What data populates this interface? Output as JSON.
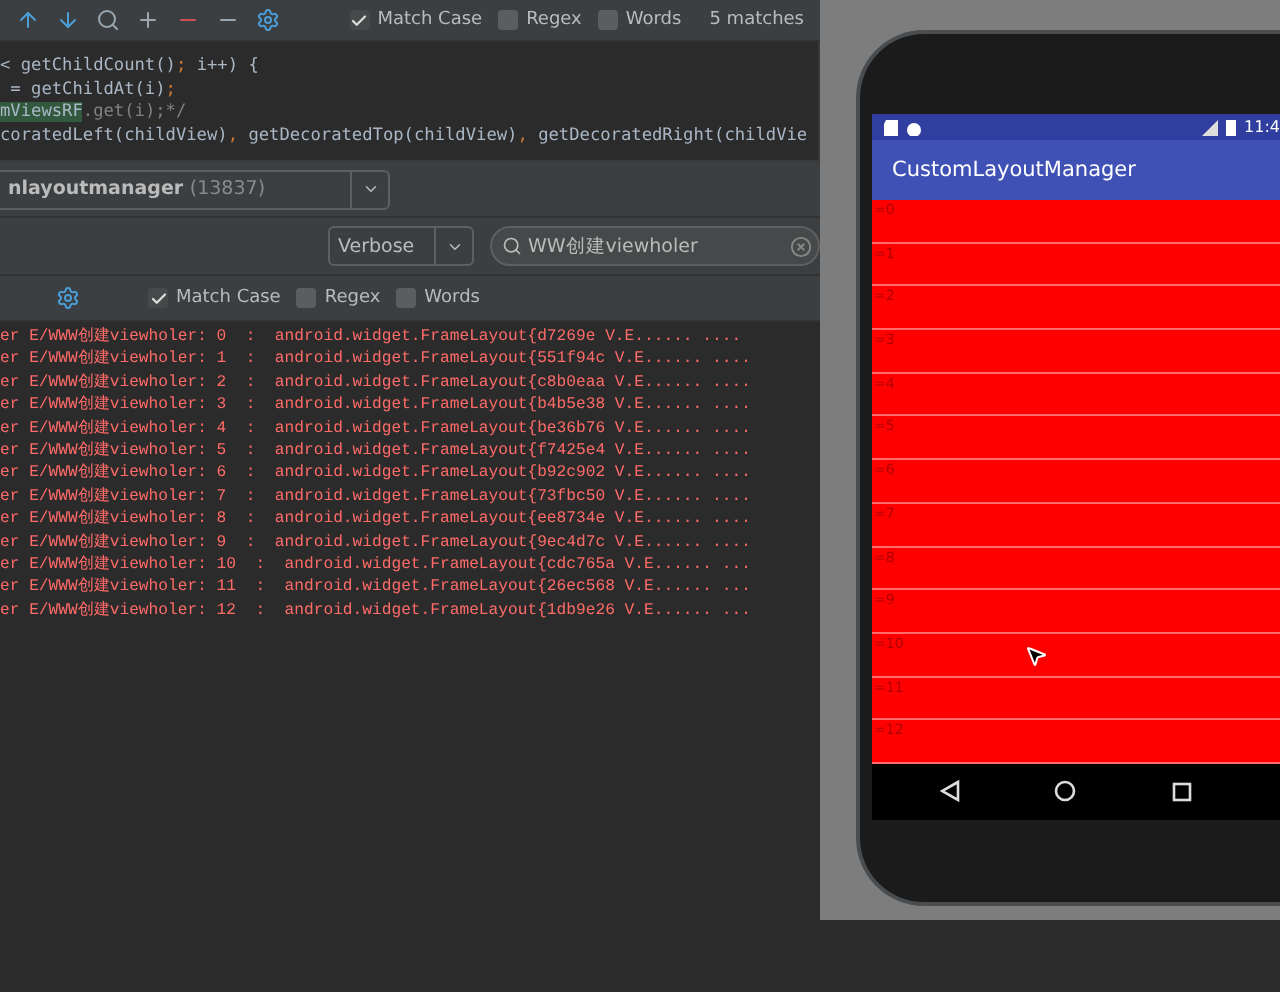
{
  "find_bar": {
    "options": [
      {
        "label": "Match Case",
        "checked": true
      },
      {
        "label": "Regex",
        "checked": false
      },
      {
        "label": "Words",
        "checked": false
      }
    ],
    "matches": "5 matches"
  },
  "code_lines": [
    [
      {
        "t": "< getChildCount()",
        "kind": "plain"
      },
      {
        "t": ";",
        "kind": "punct"
      },
      {
        "t": " i++) {",
        "kind": "plain"
      }
    ],
    [
      {
        "t": " = getChildAt(i)",
        "kind": "plain"
      },
      {
        "t": ";",
        "kind": "punct"
      }
    ],
    [
      {
        "t": "mViewsRF",
        "kind": "match"
      },
      {
        "t": ".get(i);*/",
        "kind": "comment"
      }
    ],
    [
      {
        "t": "coratedLeft(childView)",
        "kind": "plain"
      },
      {
        "t": ",",
        "kind": "punct"
      },
      {
        "t": " getDecoratedTop(childView)",
        "kind": "plain"
      },
      {
        "t": ",",
        "kind": "punct"
      },
      {
        "t": " getDecoratedRight(childVie",
        "kind": "plain"
      }
    ]
  ],
  "process": {
    "name": "nlayoutmanager",
    "pid": "(13837)"
  },
  "log_level": "Verbose",
  "log_search": {
    "value": "WW创建viewholer"
  },
  "log_find": {
    "options": [
      {
        "label": "Match Case",
        "checked": true
      },
      {
        "label": "Regex",
        "checked": false
      },
      {
        "label": "Words",
        "checked": false
      }
    ]
  },
  "log_lines": [
    "er E/WWW创建viewholer: 0  :  android.widget.FrameLayout{d7269e V.E...... ....",
    "er E/WWW创建viewholer: 1  :  android.widget.FrameLayout{551f94c V.E...... ....",
    "er E/WWW创建viewholer: 2  :  android.widget.FrameLayout{c8b0eaa V.E...... ....",
    "er E/WWW创建viewholer: 3  :  android.widget.FrameLayout{b4b5e38 V.E...... ....",
    "er E/WWW创建viewholer: 4  :  android.widget.FrameLayout{be36b76 V.E...... ....",
    "er E/WWW创建viewholer: 5  :  android.widget.FrameLayout{f7425e4 V.E...... ....",
    "er E/WWW创建viewholer: 6  :  android.widget.FrameLayout{b92c902 V.E...... ....",
    "er E/WWW创建viewholer: 7  :  android.widget.FrameLayout{73fbc50 V.E...... ....",
    "er E/WWW创建viewholer: 8  :  android.widget.FrameLayout{ee8734e V.E...... ....",
    "er E/WWW创建viewholer: 9  :  android.widget.FrameLayout{9ec4d7c V.E...... ....",
    "er E/WWW创建viewholer: 10  :  android.widget.FrameLayout{cdc765a V.E...... ...",
    "er E/WWW创建viewholer: 11  :  android.widget.FrameLayout{26ec568 V.E...... ...",
    "er E/WWW创建viewholer: 12  :  android.widget.FrameLayout{1db9e26 V.E...... ..."
  ],
  "device": {
    "time": "11:4",
    "app_title": "CustomLayoutManager",
    "items": [
      "=0",
      "=1",
      "=2",
      "=3",
      "=4",
      "=5",
      "=6",
      "=7",
      "=8",
      "=9",
      "=10",
      "=11",
      "=12"
    ]
  }
}
